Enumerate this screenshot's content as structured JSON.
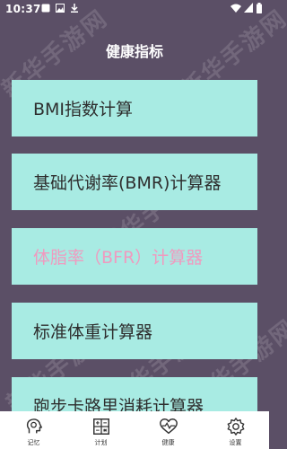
{
  "status_bar": {
    "time": "10:37",
    "icons": [
      "notification-icon",
      "image-icon",
      "download-icon",
      "wifi-icon",
      "signal-icon",
      "battery-icon"
    ]
  },
  "watermark": "新华手游网",
  "page": {
    "title": "健康指标"
  },
  "calculators": [
    {
      "label": "BMI指数计算"
    },
    {
      "label": "基础代谢率(BMR)计算器"
    },
    {
      "label": "体脂率（BFR）计算器"
    },
    {
      "label": "标准体重计算器"
    },
    {
      "label": "跑步卡路里消耗计算器"
    }
  ],
  "nav": [
    {
      "label": "记忆",
      "icon": "head-icon"
    },
    {
      "label": "计划",
      "icon": "grid-icon"
    },
    {
      "label": "健康",
      "icon": "heartbeat-icon"
    },
    {
      "label": "设置",
      "icon": "gear-icon"
    }
  ],
  "colors": {
    "background": "#5b4f66",
    "card": "#a8ebe3",
    "card_text": "#2e2e2e",
    "highlight_text": "#f09abf",
    "navbar": "#ffffff"
  }
}
